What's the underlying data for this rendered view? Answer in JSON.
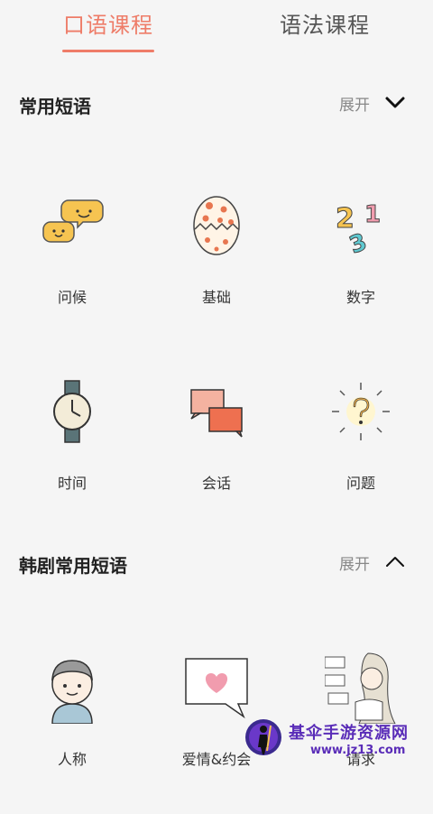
{
  "tabs": [
    {
      "label": "口语课程",
      "active": true
    },
    {
      "label": "语法课程",
      "active": false
    }
  ],
  "sections": [
    {
      "title": "常用短语",
      "expand_label": "展开",
      "items": [
        {
          "label": "问候",
          "icon": "chat-bubbles-icon"
        },
        {
          "label": "基础",
          "icon": "egg-icon"
        },
        {
          "label": "数字",
          "icon": "numbers-icon"
        },
        {
          "label": "时间",
          "icon": "watch-icon"
        },
        {
          "label": "会话",
          "icon": "conversation-icon"
        },
        {
          "label": "问题",
          "icon": "question-icon"
        }
      ]
    },
    {
      "title": "韩剧常用短语",
      "expand_label": "展开",
      "items": [
        {
          "label": "人称",
          "icon": "person-icon"
        },
        {
          "label": "爱情&约会",
          "icon": "heart-bubble-icon"
        },
        {
          "label": "请求",
          "icon": "request-icon"
        }
      ]
    }
  ],
  "watermark": {
    "title": "基伞手游资源网",
    "url": "www.jz13.com"
  },
  "colors": {
    "accent": "#ee7c68",
    "background": "#f5f5f5"
  }
}
